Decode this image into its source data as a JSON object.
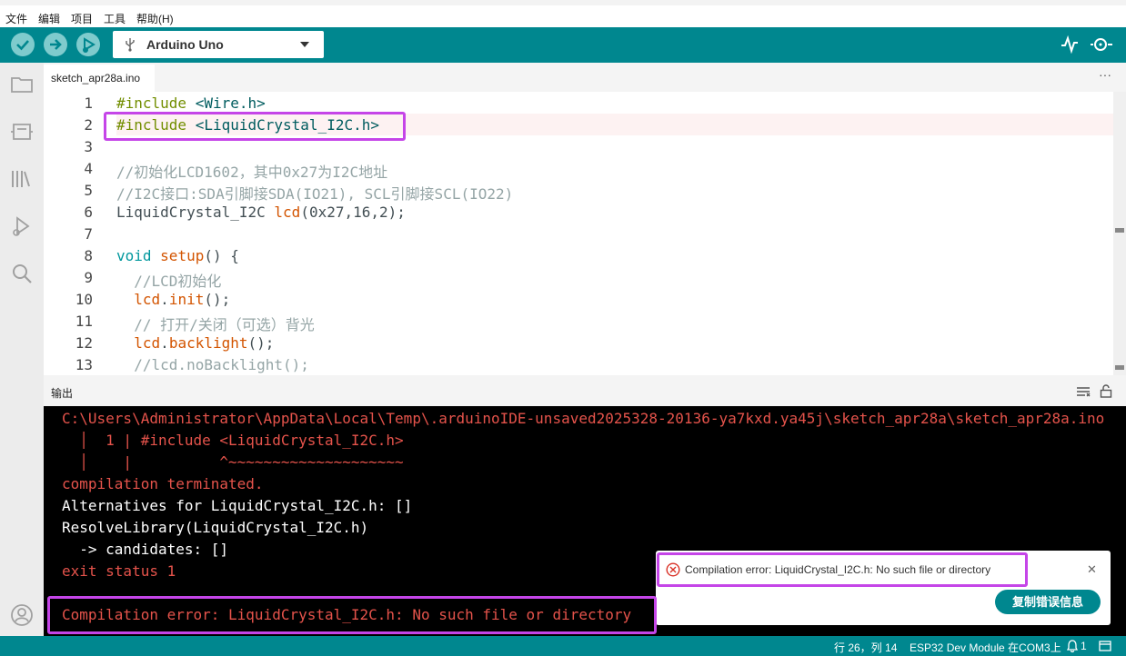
{
  "menu": {
    "file": "文件",
    "edit": "编辑",
    "project": "项目",
    "tools": "工具",
    "help": "帮助(H)"
  },
  "toolbar": {
    "board": "Arduino Uno",
    "verify_icon": "check-icon",
    "upload_icon": "arrow-right-icon",
    "debug_icon": "debug-icon"
  },
  "tab": {
    "name": "sketch_apr28a.ino",
    "more": "···"
  },
  "editor": {
    "line_numbers": [
      "1",
      "2",
      "3",
      "4",
      "5",
      "6",
      "7",
      "8",
      "9",
      "10",
      "11",
      "12",
      "13"
    ],
    "lines": {
      "l1a": "#include",
      "l1b": " <Wire.h>",
      "l2a": "#include",
      "l2b": " <LiquidCrystal_I2C.h>",
      "l4": "//初始化LCD1602，其中0x27为I2C地址",
      "l5": "//I2C接口:SDA引脚接SDA(IO21), SCL引脚接SCL(IO22)",
      "l6a": "LiquidCrystal_I2C",
      "l6b": " ",
      "l6c": "lcd",
      "l6d": "(0x27,16,2);",
      "l8a": "void",
      "l8b": " ",
      "l8c": "setup",
      "l8d": "() {",
      "l9": "  //LCD初始化",
      "l10a": "  ",
      "l10b": "lcd",
      "l10c": ".",
      "l10d": "init",
      "l10e": "();",
      "l11": "  // 打开/关闭（可选）背光",
      "l12a": "  ",
      "l12b": "lcd",
      "l12c": ".",
      "l12d": "backlight",
      "l12e": "();",
      "l13": "  //lcd.noBacklight();"
    }
  },
  "output": {
    "title": "输出",
    "lines": [
      "C:\\Users\\Administrator\\AppData\\Local\\Temp\\.arduinoIDE-unsaved2025328-20136-ya7kxd.ya45j\\sketch_apr28a\\sketch_apr28a.ino",
      "  │  1 | #include <LiquidCrystal_I2C.h>",
      "  │    |          ^~~~~~~~~~~~~~~~~~~~~",
      "compilation terminated.",
      "Alternatives for LiquidCrystal_I2C.h: []",
      "ResolveLibrary(LiquidCrystal_I2C.h)",
      "  -> candidates: []",
      "exit status 1",
      "Compilation error: LiquidCrystal_I2C.h: No such file or directory"
    ]
  },
  "toast": {
    "message": "Compilation error: LiquidCrystal_I2C.h: No such file or directory",
    "button": "复制错误信息",
    "close": "✕"
  },
  "status": {
    "position": "行 26，列 14",
    "board": "ESP32 Dev Module 在COM3上",
    "notifications": "1"
  }
}
